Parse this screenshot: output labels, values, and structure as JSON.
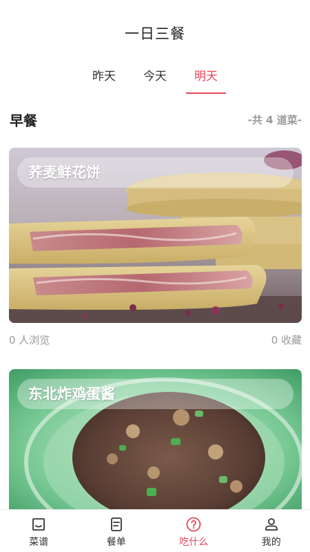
{
  "header": {
    "title": "一日三餐"
  },
  "tabs": [
    {
      "label": "昨天",
      "active": false
    },
    {
      "label": "今天",
      "active": false
    },
    {
      "label": "明天",
      "active": true
    }
  ],
  "section": {
    "title": "早餐",
    "count_text": "-共 4 道菜-"
  },
  "recipes": [
    {
      "name": "荞麦鲜花饼",
      "views": "0 人浏览",
      "favorites": "0 收藏"
    },
    {
      "name": "东北炸鸡蛋酱"
    }
  ],
  "tabbar": {
    "items": [
      {
        "label": "菜谱",
        "icon": "recipe-book-icon",
        "active": false
      },
      {
        "label": "餐单",
        "icon": "menu-list-icon",
        "active": false
      },
      {
        "label": "吃什么",
        "icon": "question-circle-icon",
        "active": true
      },
      {
        "label": "我的",
        "icon": "user-profile-icon",
        "active": false
      }
    ]
  },
  "colors": {
    "accent": "#e8465a",
    "muted": "#999999",
    "text": "#222222"
  }
}
